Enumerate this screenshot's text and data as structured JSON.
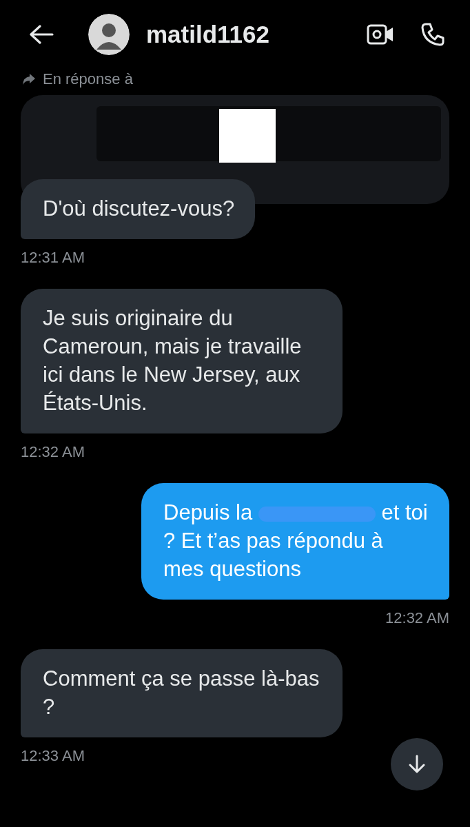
{
  "header": {
    "username": "matild1162"
  },
  "messages": [
    {
      "kind": "incoming",
      "reply_to": {
        "label": "En réponse à",
        "kind": "redacted"
      },
      "segments": [
        {
          "kind": "text",
          "text": "D'où discutez-vous?"
        }
      ],
      "time": "12:31 AM"
    },
    {
      "kind": "incoming",
      "segments": [
        {
          "kind": "text",
          "text": "Je suis originaire du Cameroun, mais je travaille ici dans le New Jersey, aux États-Unis."
        }
      ],
      "time": "12:32 AM"
    },
    {
      "kind": "outgoing",
      "segments": [
        {
          "kind": "text",
          "text": "Depuis la"
        },
        {
          "kind": "redaction"
        },
        {
          "kind": "text",
          "text": "et toi ? Et t’as pas répondu à mes questions"
        }
      ],
      "time": "12:32 AM"
    },
    {
      "kind": "incoming",
      "segments": [
        {
          "kind": "text",
          "text": "Comment ça se passe là-bas ?"
        }
      ],
      "time": "12:33 AM"
    }
  ]
}
